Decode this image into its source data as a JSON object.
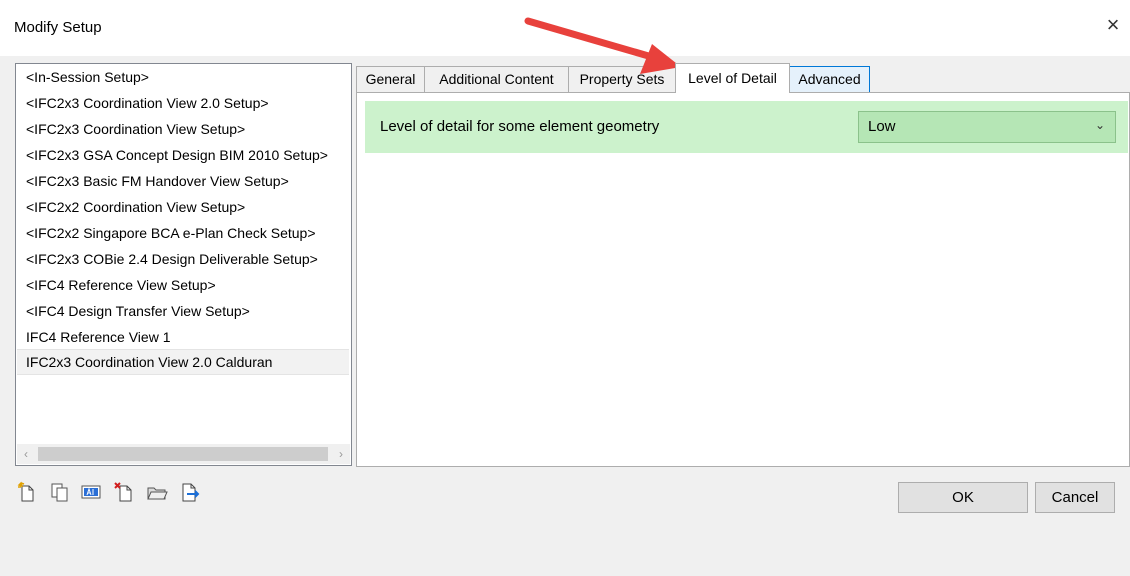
{
  "window": {
    "title": "Modify Setup",
    "close_glyph": "×"
  },
  "setups": {
    "items": [
      "<In-Session Setup>",
      "<IFC2x3 Coordination View 2.0 Setup>",
      "<IFC2x3 Coordination View Setup>",
      "<IFC2x3 GSA Concept Design BIM 2010 Setup>",
      "<IFC2x3 Basic FM Handover View Setup>",
      "<IFC2x2 Coordination View Setup>",
      "<IFC2x2 Singapore BCA e-Plan Check Setup>",
      "<IFC2x3 COBie 2.4 Design Deliverable Setup>",
      "<IFC4 Reference View Setup>",
      "<IFC4 Design Transfer View Setup>",
      "IFC4 Reference View 1",
      "IFC2x3 Coordination View 2.0 Calduran"
    ],
    "selected_index": 11,
    "scroll_left_glyph": "‹",
    "scroll_right_glyph": "›"
  },
  "tabs": [
    "General",
    "Additional Content",
    "Property Sets",
    "Level of Detail",
    "Advanced"
  ],
  "active_tab": "Level of Detail",
  "level_of_detail": {
    "label": "Level of detail for some element geometry",
    "value": "Low",
    "chevron_glyph": "⌄"
  },
  "toolbar_icons": [
    "new-setup-icon",
    "duplicate-setup-icon",
    "rename-setup-icon",
    "delete-setup-icon",
    "import-setup-icon",
    "export-setup-icon"
  ],
  "buttons": {
    "ok": "OK",
    "cancel": "Cancel"
  },
  "colors": {
    "accent": "#0078d7",
    "row_background": "#ccf2cc",
    "select_background": "#b5e6b5",
    "annotation_arrow": "#e8413c"
  }
}
